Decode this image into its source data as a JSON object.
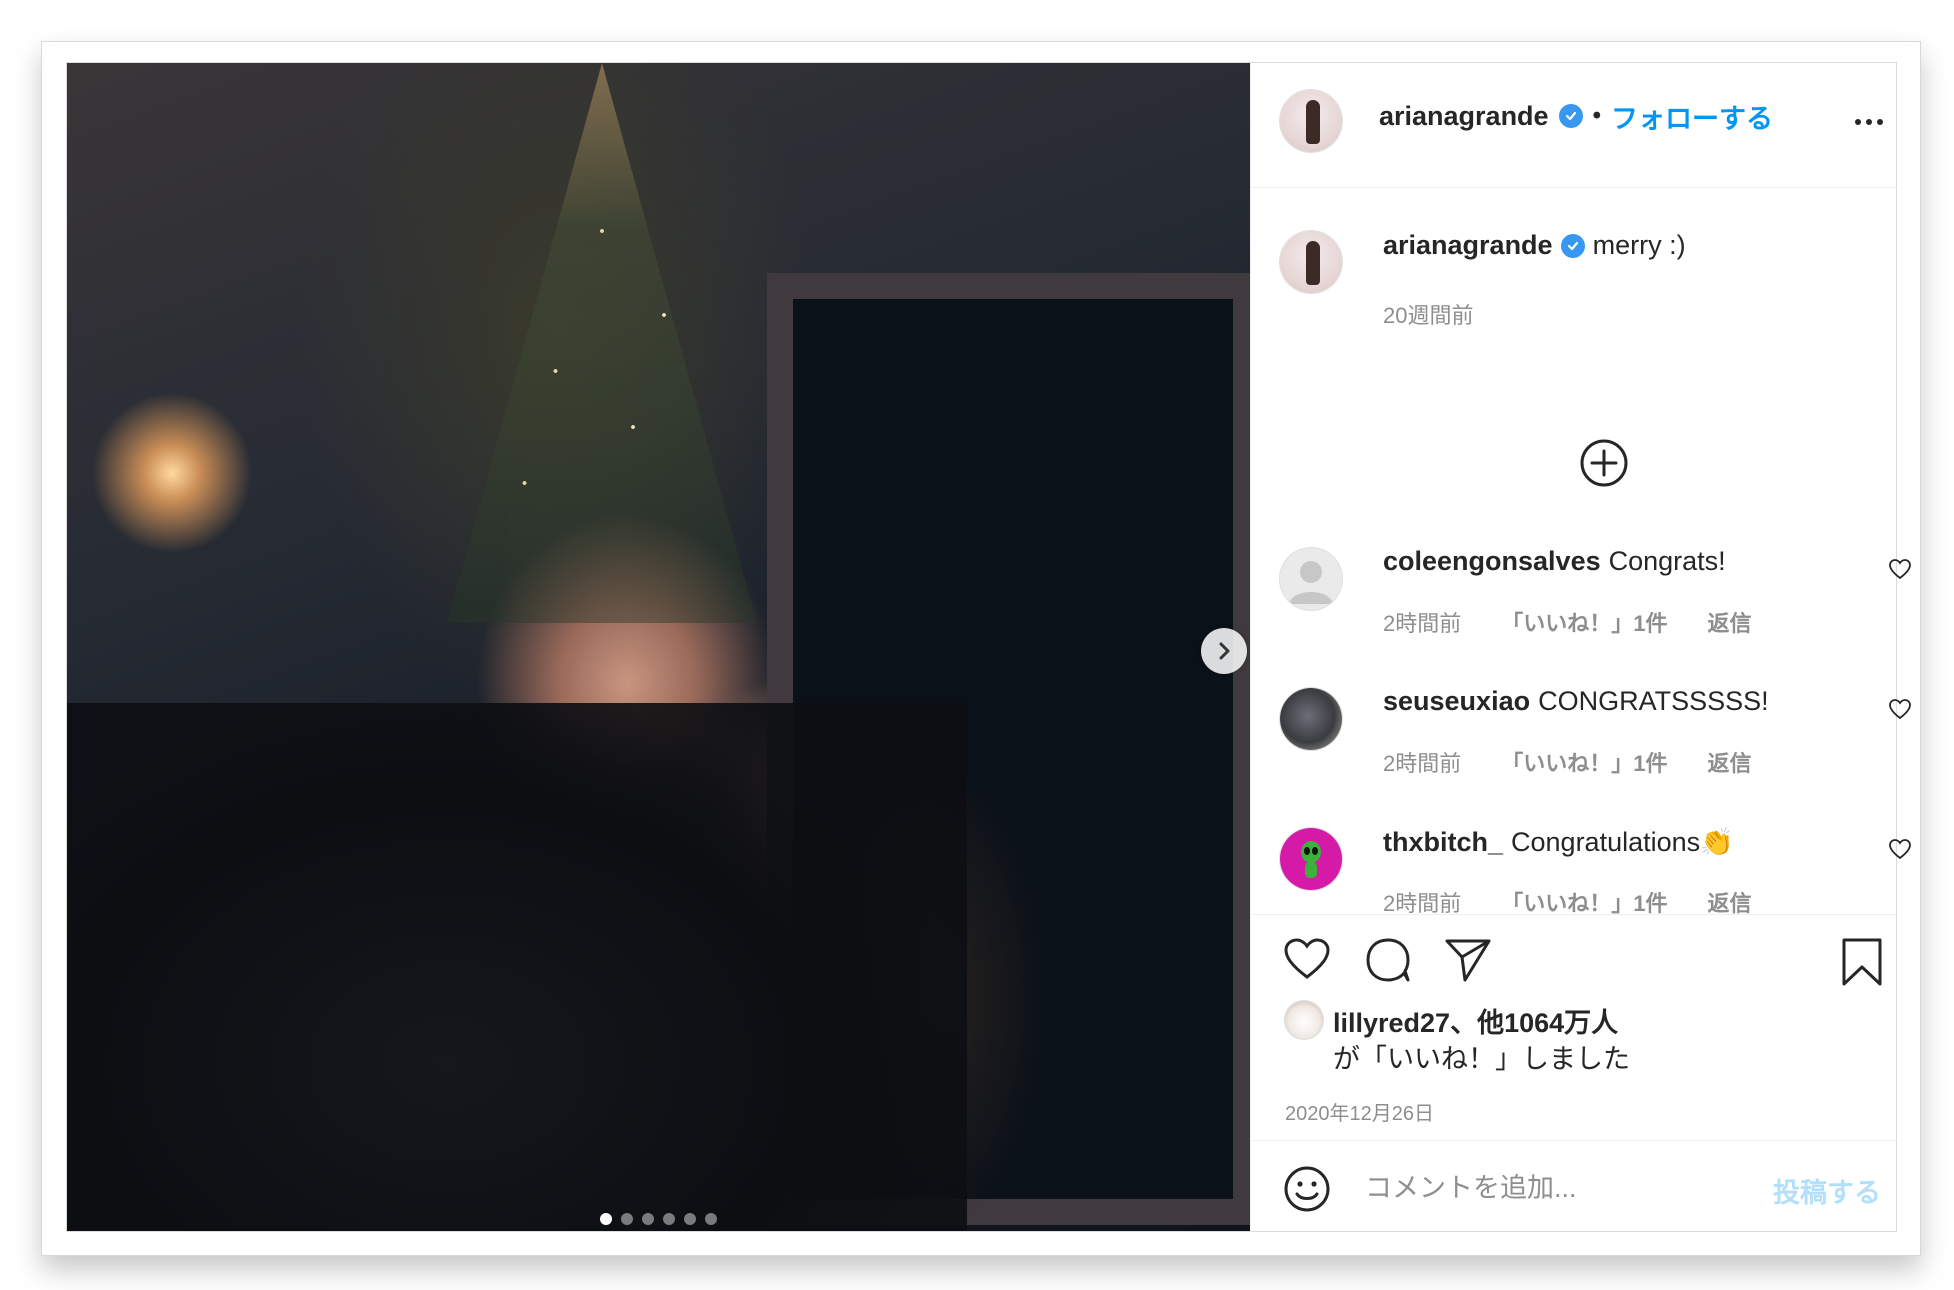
{
  "post": {
    "author": {
      "username": "arianagrande",
      "verified": true,
      "separator": "•",
      "follow_label": "フォローする"
    },
    "caption": {
      "username": "arianagrande",
      "text": "merry :)",
      "time": "20週間前"
    },
    "carousel": {
      "total": 6,
      "current": 1
    },
    "comments": [
      {
        "username": "coleengonsalves",
        "text": "Congrats!",
        "time": "2時間前",
        "likes": "「いいね！」1件",
        "reply": "返信",
        "avatar_icon": "default-avatar-icon"
      },
      {
        "username": "seuseuxiao",
        "text": "CONGRATSSSSS!",
        "time": "2時間前",
        "likes": "「いいね！」1件",
        "reply": "返信",
        "avatar_icon": "photo-avatar"
      },
      {
        "username": "thxbitch_",
        "text": "Congratulations",
        "emoji": "👏",
        "time": "2時間前",
        "likes": "「いいね！」1件",
        "reply": "返信",
        "avatar_icon": "alien-avatar"
      }
    ],
    "likes": {
      "line1": "lillyred27、他1064万人",
      "line2": "が「いいね！」しました"
    },
    "date": "2020年12月26日",
    "add_comment": {
      "placeholder": "コメントを追加...",
      "submit_label": "投稿する"
    }
  },
  "colors": {
    "accent": "#0095f6",
    "verified": "#3897f0",
    "muted": "#8e8e8e",
    "submit_disabled": "#b2dffc",
    "alien_avatar_bg": "#d61aa8"
  }
}
